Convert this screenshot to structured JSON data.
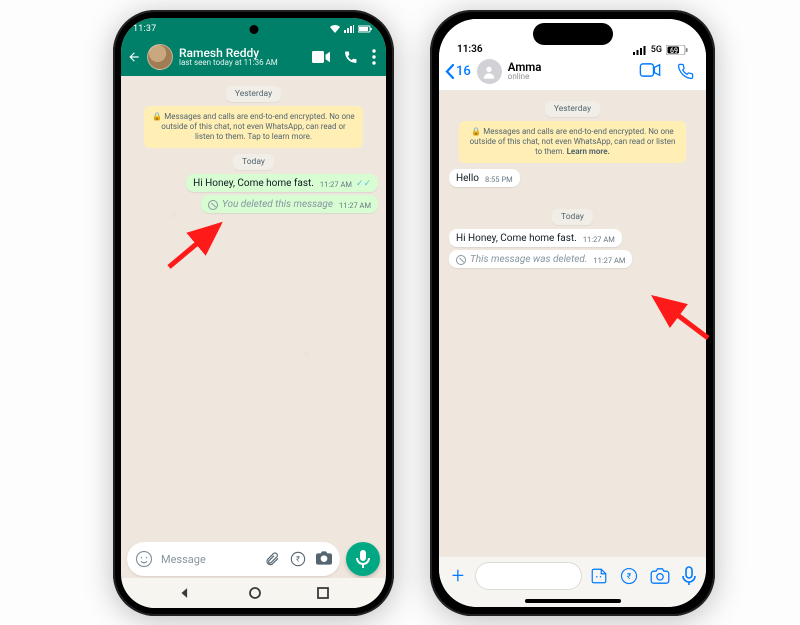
{
  "android": {
    "statusbar": {
      "time": "11:37",
      "signal_label": "signal",
      "wifi_label": "wifi",
      "battery_label": "battery"
    },
    "header": {
      "back_label": "Back",
      "name": "Ramesh Reddy",
      "status": "last seen today at 11:36 AM",
      "video_label": "Video call",
      "voice_label": "Voice call",
      "menu_label": "Menu"
    },
    "date_yesterday": "Yesterday",
    "encryption_text": "Messages and calls are end-to-end encrypted. No one outside of this chat, not even WhatsApp, can read or listen to them. Tap to learn more.",
    "date_today": "Today",
    "msg_out_text": "Hi Honey, Come home fast.",
    "msg_out_time": "11:27 AM",
    "deleted_text": "You deleted this message",
    "deleted_time": "11:27 AM",
    "input_placeholder": "Message",
    "emoji_label": "Emoji",
    "attach_label": "Attach",
    "pay_label": "Payment",
    "camera_label": "Camera",
    "mic_label": "Voice message",
    "nav_back": "Back",
    "nav_home": "Home",
    "nav_recent": "Recents"
  },
  "ios": {
    "statusbar": {
      "time": "11:36",
      "network": "5G",
      "battery": "69"
    },
    "header": {
      "back_count": "16",
      "name": "Amma",
      "status": "online",
      "video_label": "Video call",
      "voice_label": "Voice call"
    },
    "date_yesterday": "Yesterday",
    "encryption_text_a": "Messages and calls are end-to-end encrypted. No one outside of this chat, not even WhatsApp, can read or listen to them. ",
    "encryption_learn": "Learn more.",
    "msg_in_text": "Hello",
    "msg_in_time": "8:55 PM",
    "date_today": "Today",
    "msg_in2_text": "Hi Honey, Come home fast.",
    "msg_in2_time": "11:27 AM",
    "deleted_text": "This message was deleted.",
    "deleted_time": "11:27 AM",
    "plus_label": "Add",
    "sticker_label": "Sticker",
    "pay_label": "Payment",
    "camera_label": "Camera",
    "mic_label": "Voice message"
  }
}
